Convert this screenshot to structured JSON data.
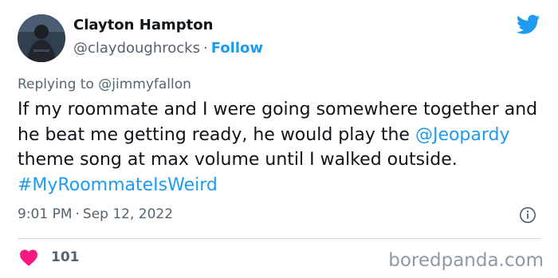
{
  "author": {
    "name": "Clayton Hampton",
    "handle": "@claydoughrocks",
    "separator": "·",
    "follow_label": "Follow"
  },
  "reply": {
    "prefix": "Replying to",
    "mention": "@jimmyfallon"
  },
  "tweet": {
    "text_part1": "If my roommate and I were going somewhere together and he beat me getting ready, he would play the ",
    "mention": "@Jeopardy",
    "text_part2": " theme song at max volume until I walked outside. ",
    "hashtag": "#MyRoommateIsWeird"
  },
  "meta": {
    "time": "9:01 PM",
    "separator": "·",
    "date": "Sep 12, 2022"
  },
  "engagement": {
    "likes": "101"
  },
  "watermark": "boredpanda.com",
  "icons": {
    "brand": "twitter-bird-icon",
    "info": "info-icon",
    "like": "heart-icon"
  },
  "colors": {
    "link": "#1d9bf0",
    "heart": "#f91880",
    "muted": "#536471",
    "text": "#0f1419"
  }
}
